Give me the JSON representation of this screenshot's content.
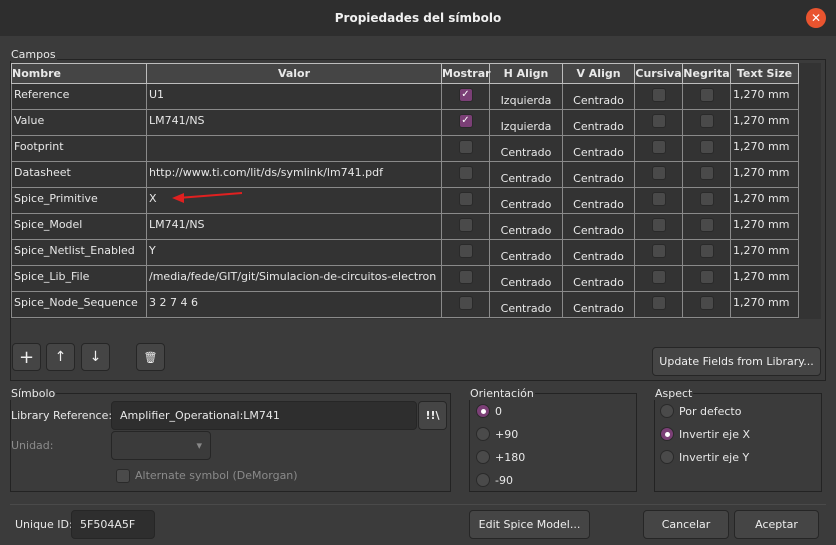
{
  "window": {
    "title": "Propiedades del símbolo",
    "close_icon": "close-icon"
  },
  "fields": {
    "label": "Campos",
    "columns": [
      "Nombre",
      "Valor",
      "Mostrar",
      "H Align",
      "V Align",
      "Cursiva",
      "Negrita",
      "Text Size"
    ],
    "rows": [
      {
        "name": "Reference",
        "value": "U1",
        "show": true,
        "h": "Izquierda",
        "v": "Centrado",
        "italic": false,
        "bold": false,
        "size": "1,270 mm"
      },
      {
        "name": "Value",
        "value": "LM741/NS",
        "show": true,
        "h": "Izquierda",
        "v": "Centrado",
        "italic": false,
        "bold": false,
        "size": "1,270 mm"
      },
      {
        "name": "Footprint",
        "value": "",
        "show": false,
        "h": "Centrado",
        "v": "Centrado",
        "italic": false,
        "bold": false,
        "size": "1,270 mm"
      },
      {
        "name": "Datasheet",
        "value": "http://www.ti.com/lit/ds/symlink/lm741.pdf",
        "show": false,
        "h": "Centrado",
        "v": "Centrado",
        "italic": false,
        "bold": false,
        "size": "1,270 mm"
      },
      {
        "name": "Spice_Primitive",
        "value": "X",
        "show": false,
        "h": "Centrado",
        "v": "Centrado",
        "italic": false,
        "bold": false,
        "size": "1,270 mm"
      },
      {
        "name": "Spice_Model",
        "value": "LM741/NS",
        "show": false,
        "h": "Centrado",
        "v": "Centrado",
        "italic": false,
        "bold": false,
        "size": "1,270 mm"
      },
      {
        "name": "Spice_Netlist_Enabled",
        "value": "Y",
        "show": false,
        "h": "Centrado",
        "v": "Centrado",
        "italic": false,
        "bold": false,
        "size": "1,270 mm"
      },
      {
        "name": "Spice_Lib_File",
        "value": "/media/fede/GIT/git/Simulacion-de-circuitos-electron",
        "show": false,
        "h": "Centrado",
        "v": "Centrado",
        "italic": false,
        "bold": false,
        "size": "1,270 mm"
      },
      {
        "name": "Spice_Node_Sequence",
        "value": "3 2 7 4 6",
        "show": false,
        "h": "Centrado",
        "v": "Centrado",
        "italic": false,
        "bold": false,
        "size": "1,270 mm"
      }
    ],
    "update_button": "Update Fields from Library...",
    "annotation_color": "#e02020"
  },
  "symbol": {
    "label": "Símbolo",
    "library_reference_label": "Library Reference:",
    "library_reference_value": "Amplifier_Operational:LM741",
    "unit_label": "Unidad:",
    "alternate_label": "Alternate symbol (DeMorgan)"
  },
  "orientation": {
    "label": "Orientación",
    "options": [
      "0",
      "+90",
      "+180",
      "-90"
    ],
    "selected": "0"
  },
  "aspect": {
    "label": "Aspect",
    "options": [
      "Por defecto",
      "Invertir eje X",
      "Invertir eje Y"
    ],
    "selected": "Invertir eje X"
  },
  "footer": {
    "unique_id_label": "Unique ID:",
    "unique_id_value": "5F504A5F",
    "edit_spice": "Edit Spice Model...",
    "cancel": "Cancelar",
    "ok": "Aceptar"
  },
  "colors": {
    "accent": "#7b3f76",
    "close": "#e9542f"
  }
}
